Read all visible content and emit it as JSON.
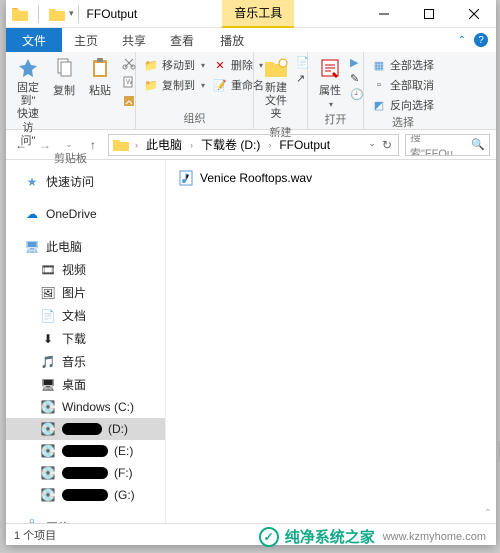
{
  "titlebar": {
    "title": "FFOutput",
    "music_tab": "音乐工具"
  },
  "tabs": {
    "file": "文件",
    "home": "主页",
    "share": "共享",
    "view": "查看",
    "play": "播放"
  },
  "ribbon": {
    "clipboard": {
      "pin": "固定到\"\n快速访问\"",
      "copy": "复制",
      "paste": "粘贴",
      "label": "剪贴板"
    },
    "organize": {
      "moveto": "移动到",
      "delete": "删除",
      "copyto": "复制到",
      "rename": "重命名",
      "label": "组织"
    },
    "new": {
      "newfolder": "新建\n文件夹",
      "label": "新建"
    },
    "open": {
      "props": "属性",
      "label": "打开"
    },
    "select": {
      "all": "全部选择",
      "none": "全部取消",
      "invert": "反向选择",
      "label": "选择"
    }
  },
  "breadcrumb": {
    "items": [
      "此电脑",
      "下载卷 (D:)",
      "FFOutput"
    ]
  },
  "search": {
    "placeholder": "搜索\"FFOu..."
  },
  "tree": {
    "quick": "快速访问",
    "onedrive": "OneDrive",
    "thispc": "此电脑",
    "children": [
      {
        "icon": "video",
        "label": "视频"
      },
      {
        "icon": "pictures",
        "label": "图片"
      },
      {
        "icon": "docs",
        "label": "文档"
      },
      {
        "icon": "downloads",
        "label": "下载"
      },
      {
        "icon": "music",
        "label": "音乐"
      },
      {
        "icon": "desktop",
        "label": "桌面"
      },
      {
        "icon": "drive-c",
        "label": "Windows (C:)"
      },
      {
        "icon": "drive",
        "label": "(D:)",
        "sel": true,
        "redact_w": 40
      },
      {
        "icon": "drive",
        "label": "(E:)",
        "redact_w": 46
      },
      {
        "icon": "drive",
        "label": "(F:)",
        "redact_w": 46
      },
      {
        "icon": "drive",
        "label": "(G:)",
        "redact_w": 46
      }
    ],
    "network": "网络"
  },
  "files": [
    {
      "name": "Venice Rooftops.wav",
      "type": "wav"
    }
  ],
  "status": {
    "count": "1 个项目"
  },
  "watermark": {
    "brand": "纯净系统之家",
    "url": "www.kzmyhome.com"
  }
}
